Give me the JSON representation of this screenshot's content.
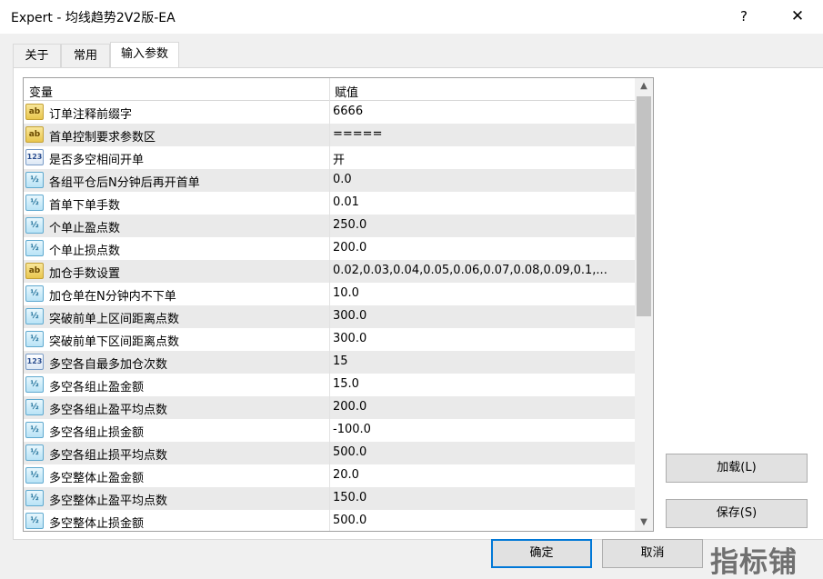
{
  "window": {
    "title": "Expert - 均线趋势2V2版-EA",
    "help_label": "?",
    "close_label": "✕"
  },
  "tabs": [
    {
      "label": "关于"
    },
    {
      "label": "常用"
    },
    {
      "label": "输入参数"
    }
  ],
  "active_tab": "输入参数",
  "grid": {
    "headers": {
      "variable": "变量",
      "value": "赋值"
    },
    "rows": [
      {
        "icon": "ab",
        "variable": "订单注释前缀字",
        "value": "6666"
      },
      {
        "icon": "ab",
        "variable": "首单控制要求参数区",
        "value": "====="
      },
      {
        "icon": "123",
        "variable": "是否多空相间开单",
        "value": "开"
      },
      {
        "icon": "v2",
        "variable": "各组平仓后N分钟后再开首单",
        "value": "0.0"
      },
      {
        "icon": "v2",
        "variable": "首单下单手数",
        "value": "0.01"
      },
      {
        "icon": "v2",
        "variable": "个单止盈点数",
        "value": "250.0"
      },
      {
        "icon": "v2",
        "variable": "个单止损点数",
        "value": "200.0"
      },
      {
        "icon": "ab",
        "variable": "加仓手数设置",
        "value": "0.02,0.03,0.04,0.05,0.06,0.07,0.08,0.09,0.1,..."
      },
      {
        "icon": "v2",
        "variable": "加仓单在N分钟内不下单",
        "value": "10.0"
      },
      {
        "icon": "v2",
        "variable": "突破前单上区间距离点数",
        "value": "300.0"
      },
      {
        "icon": "v2",
        "variable": "突破前单下区间距离点数",
        "value": "300.0"
      },
      {
        "icon": "123",
        "variable": "多空各自最多加仓次数",
        "value": "15"
      },
      {
        "icon": "v2",
        "variable": "多空各组止盈金额",
        "value": "15.0"
      },
      {
        "icon": "v2",
        "variable": "多空各组止盈平均点数",
        "value": "200.0"
      },
      {
        "icon": "v2",
        "variable": "多空各组止损金额",
        "value": "-100.0"
      },
      {
        "icon": "v2",
        "variable": "多空各组止损平均点数",
        "value": "500.0"
      },
      {
        "icon": "v2",
        "variable": "多空整体止盈金额",
        "value": "20.0"
      },
      {
        "icon": "v2",
        "variable": "多空整体止盈平均点数",
        "value": "150.0"
      },
      {
        "icon": "v2",
        "variable": "多空整体止损金额",
        "value": "500.0"
      }
    ]
  },
  "icon_glyphs": {
    "ab": "ab",
    "123": "123",
    "v2": "½"
  },
  "buttons": {
    "load": "加载(L)",
    "save": "保存(S)",
    "ok": "确定",
    "cancel": "取消"
  },
  "watermark": "指标铺",
  "colors": {
    "default_button_border": "#0078d7",
    "row_alt": "#eaeaea"
  }
}
